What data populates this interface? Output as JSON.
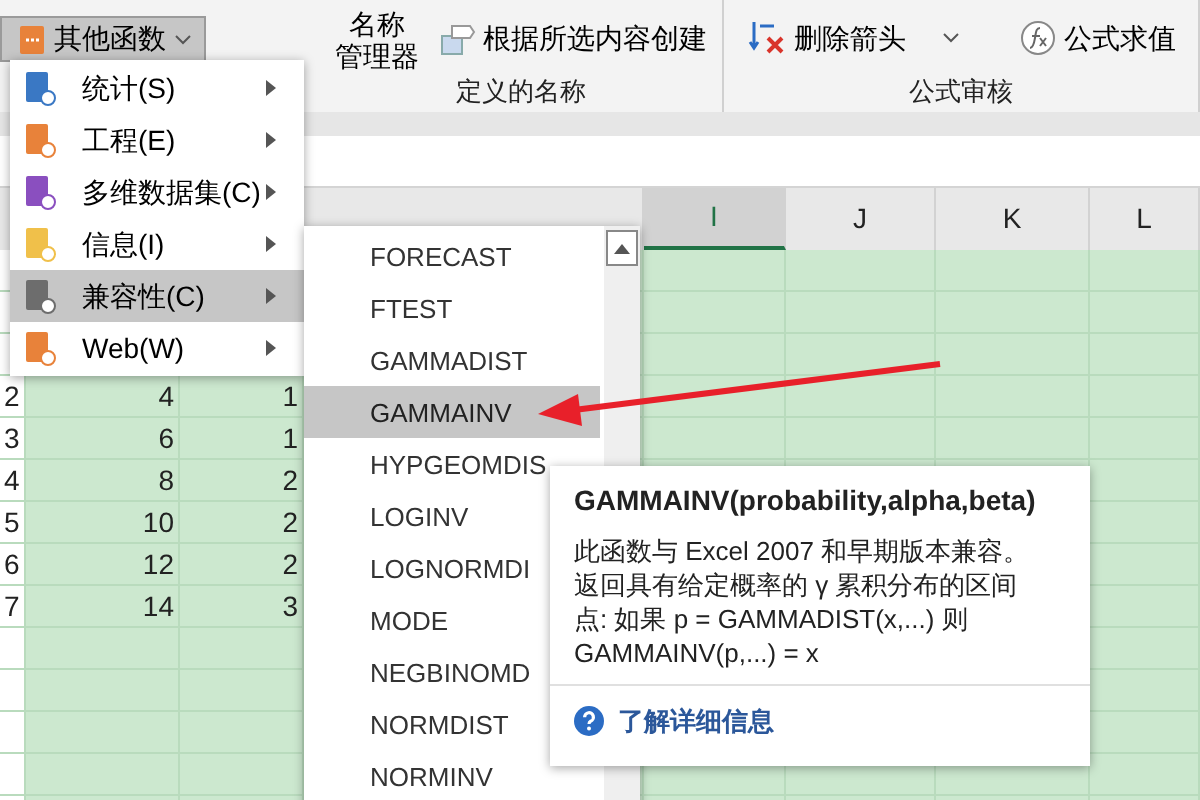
{
  "ribbon": {
    "functions_button": {
      "label": "其他函数",
      "pressed": true
    },
    "groups": [
      {
        "name": "定义的名称",
        "commands": [
          {
            "kind": "large",
            "lines": [
              "名称",
              "管理器"
            ]
          },
          {
            "kind": "small",
            "label": "根据所选内容创建",
            "dropdown": false
          }
        ]
      },
      {
        "name": "公式审核",
        "commands": [
          {
            "kind": "small",
            "label": "删除箭头",
            "dropdown": true
          },
          {
            "kind": "small",
            "label": "公式求值",
            "dropdown": false
          }
        ]
      }
    ]
  },
  "sheet": {
    "columns": [
      {
        "label": "I",
        "selected": true
      },
      {
        "label": "J",
        "selected": false
      },
      {
        "label": "K",
        "selected": false
      },
      {
        "label": "L",
        "selected": false
      }
    ],
    "rows": [
      [
        "2",
        "4",
        "1"
      ],
      [
        "3",
        "6",
        "1"
      ],
      [
        "4",
        "8",
        "2"
      ],
      [
        "5",
        "10",
        "2"
      ],
      [
        "6",
        "12",
        "2"
      ],
      [
        "7",
        "14",
        "3"
      ]
    ]
  },
  "function_menu": {
    "items": [
      {
        "label": "统计(S)",
        "color": "#3a78c4",
        "selected": false
      },
      {
        "label": "工程(E)",
        "color": "#e8823a",
        "selected": false
      },
      {
        "label": "多维数据集(C)",
        "color": "#8a4fbf",
        "selected": false
      },
      {
        "label": "信息(I)",
        "color": "#f0c04a",
        "selected": false
      },
      {
        "label": "兼容性(C)",
        "color": "#6d6d6d",
        "selected": true
      },
      {
        "label": "Web(W)",
        "color": "#e8823a",
        "selected": false
      }
    ]
  },
  "submenu": {
    "items": [
      {
        "label": "FORECAST",
        "selected": false
      },
      {
        "label": "FTEST",
        "selected": false
      },
      {
        "label": "GAMMADIST",
        "selected": false
      },
      {
        "label": "GAMMAINV",
        "selected": true
      },
      {
        "label": "HYPGEOMDIS",
        "selected": false
      },
      {
        "label": "LOGINV",
        "selected": false
      },
      {
        "label": "LOGNORMDI",
        "selected": false
      },
      {
        "label": "MODE",
        "selected": false
      },
      {
        "label": "NEGBINOMD",
        "selected": false
      },
      {
        "label": "NORMDIST",
        "selected": false
      },
      {
        "label": "NORMINV",
        "selected": false
      }
    ]
  },
  "tooltip": {
    "title": "GAMMAINV(probability,alpha,beta)",
    "description": "此函数与 Excel 2007 和早期版本兼容。返回具有给定概率的 γ 累积分布的区间点: 如果 p = GAMMADIST(x,...) 则 GAMMAINV(p,...) = x",
    "link": "了解详细信息"
  }
}
